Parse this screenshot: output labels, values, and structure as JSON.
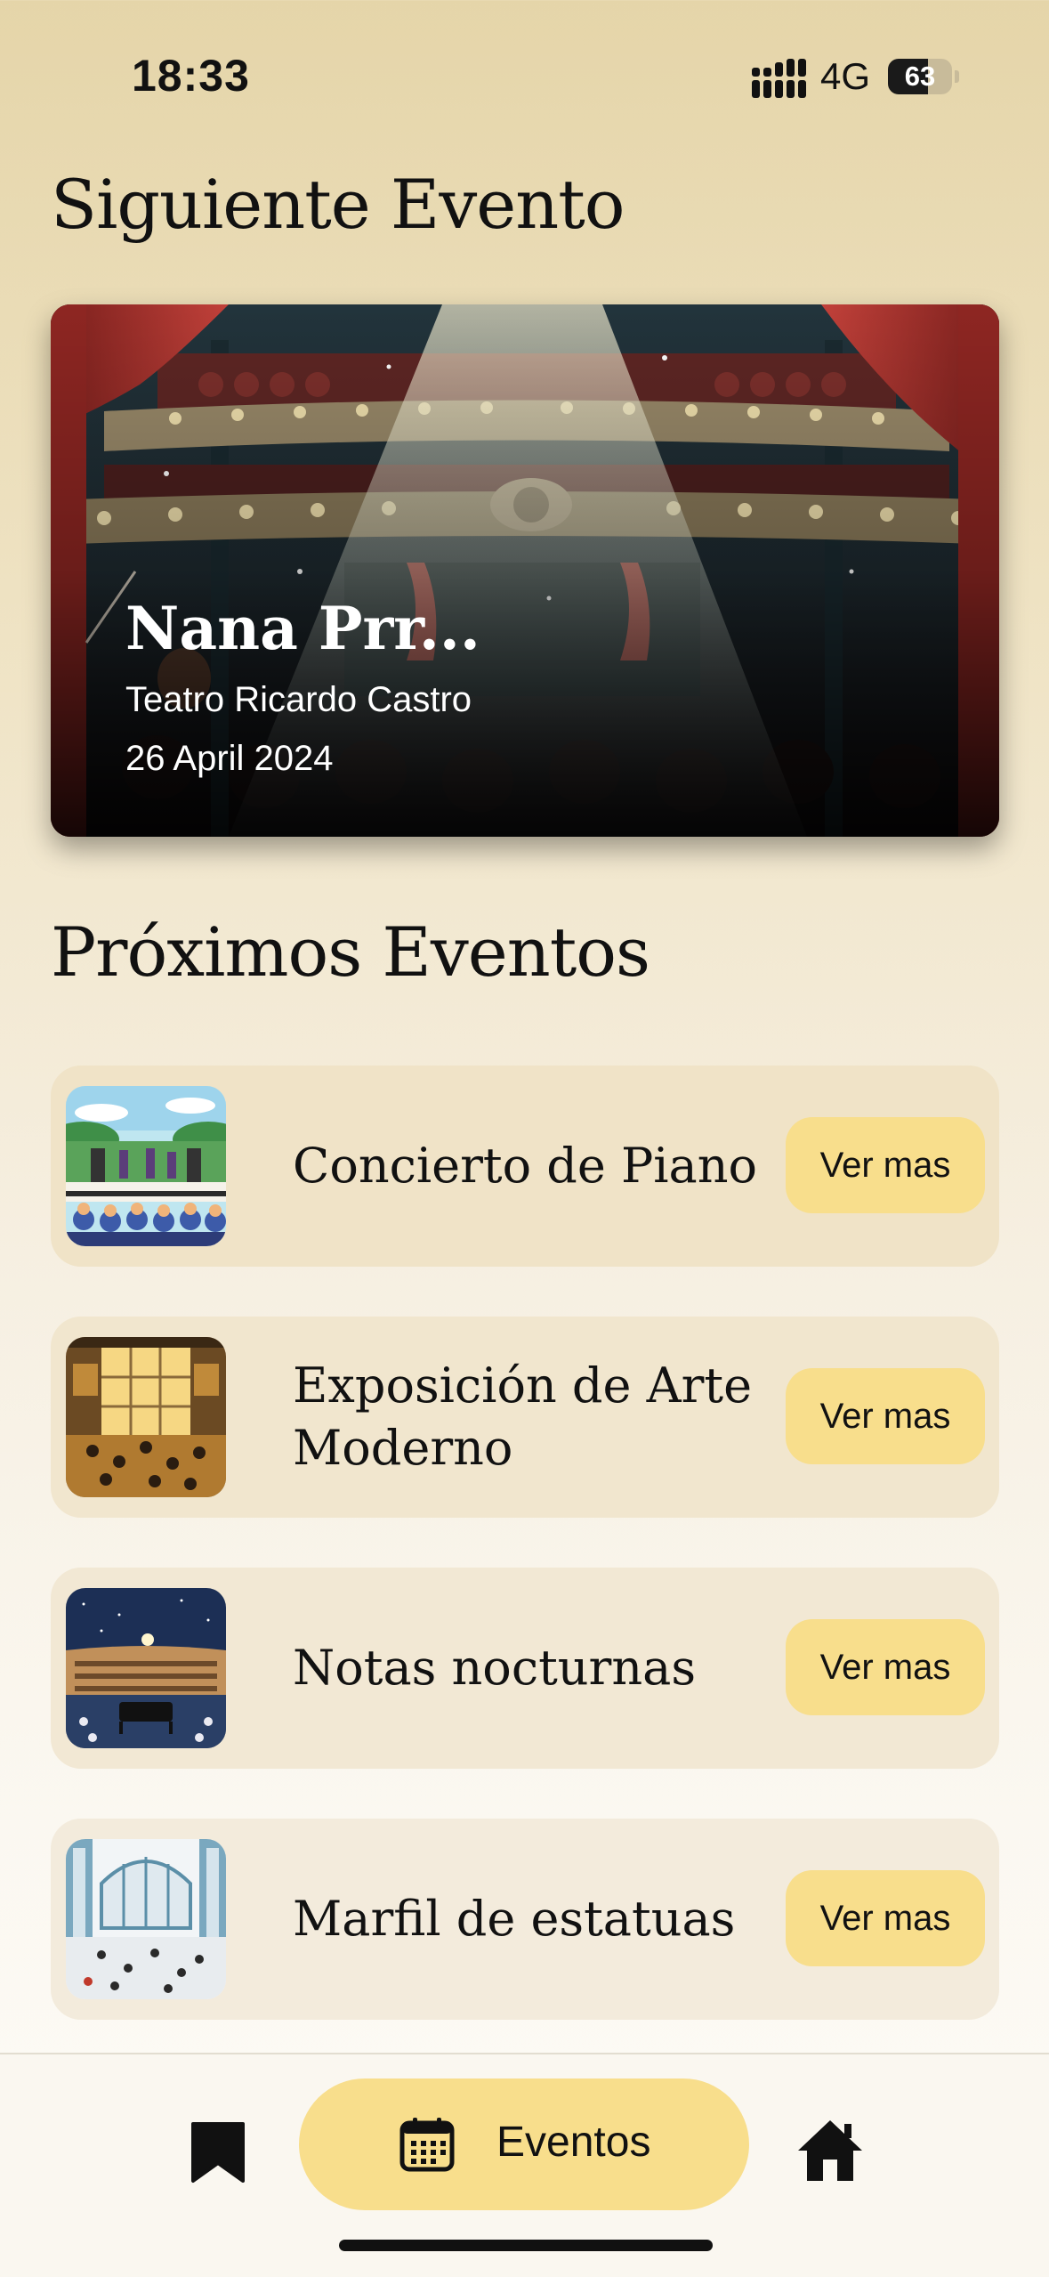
{
  "status": {
    "time": "18:33",
    "network": "4G",
    "battery": "63",
    "battery_level": 0.63
  },
  "next_event": {
    "section_title": "Siguiente Evento",
    "title": "Nana Prr...",
    "venue": "Teatro Ricardo Castro",
    "date": "26 April 2024"
  },
  "upcoming": {
    "section_title": "Próximos Eventos",
    "button_label": "Ver mas",
    "events": [
      {
        "name": "Concierto de Piano",
        "thumb": "outdoor-concert"
      },
      {
        "name": "Exposición de Arte Moderno",
        "thumb": "art-gallery"
      },
      {
        "name": "Notas nocturnas",
        "thumb": "night-piano"
      },
      {
        "name": "Marfil de estatuas",
        "thumb": "statue-hall"
      }
    ]
  },
  "nav": {
    "items": [
      {
        "icon": "bookmark-icon"
      },
      {
        "icon": "calendar-icon",
        "label": "Eventos",
        "active": true
      },
      {
        "icon": "home-icon"
      }
    ]
  },
  "colors": {
    "accent": "#f8de8c",
    "card": "#f0e5cc",
    "text": "#111111"
  }
}
